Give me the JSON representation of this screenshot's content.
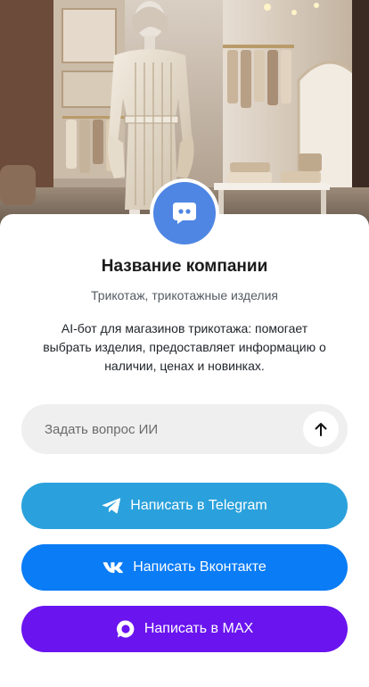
{
  "company": {
    "name": "Название компании",
    "category": "Трикотаж, трикотажные изделия",
    "description": "AI-бот для магазинов трикотажа: помогает выбрать изделия, предоставляет информацию о наличии, ценах и новинках."
  },
  "ask": {
    "placeholder": "Задать вопрос ИИ",
    "send_icon": "arrow-up-icon"
  },
  "buttons": {
    "telegram": {
      "label": "Написать в Telegram",
      "icon": "telegram-icon",
      "color": "#2aa1dc"
    },
    "vk": {
      "label": "Написать Вконтакте",
      "icon": "vk-icon",
      "color": "#0a7cf5"
    },
    "max": {
      "label": "Написать в MAX",
      "icon": "max-icon",
      "color": "#6a14f0"
    }
  },
  "avatar": {
    "icon": "chat-bot-icon",
    "color": "#4f86e3"
  },
  "hero": {
    "icon": "knitwear-store-image"
  }
}
